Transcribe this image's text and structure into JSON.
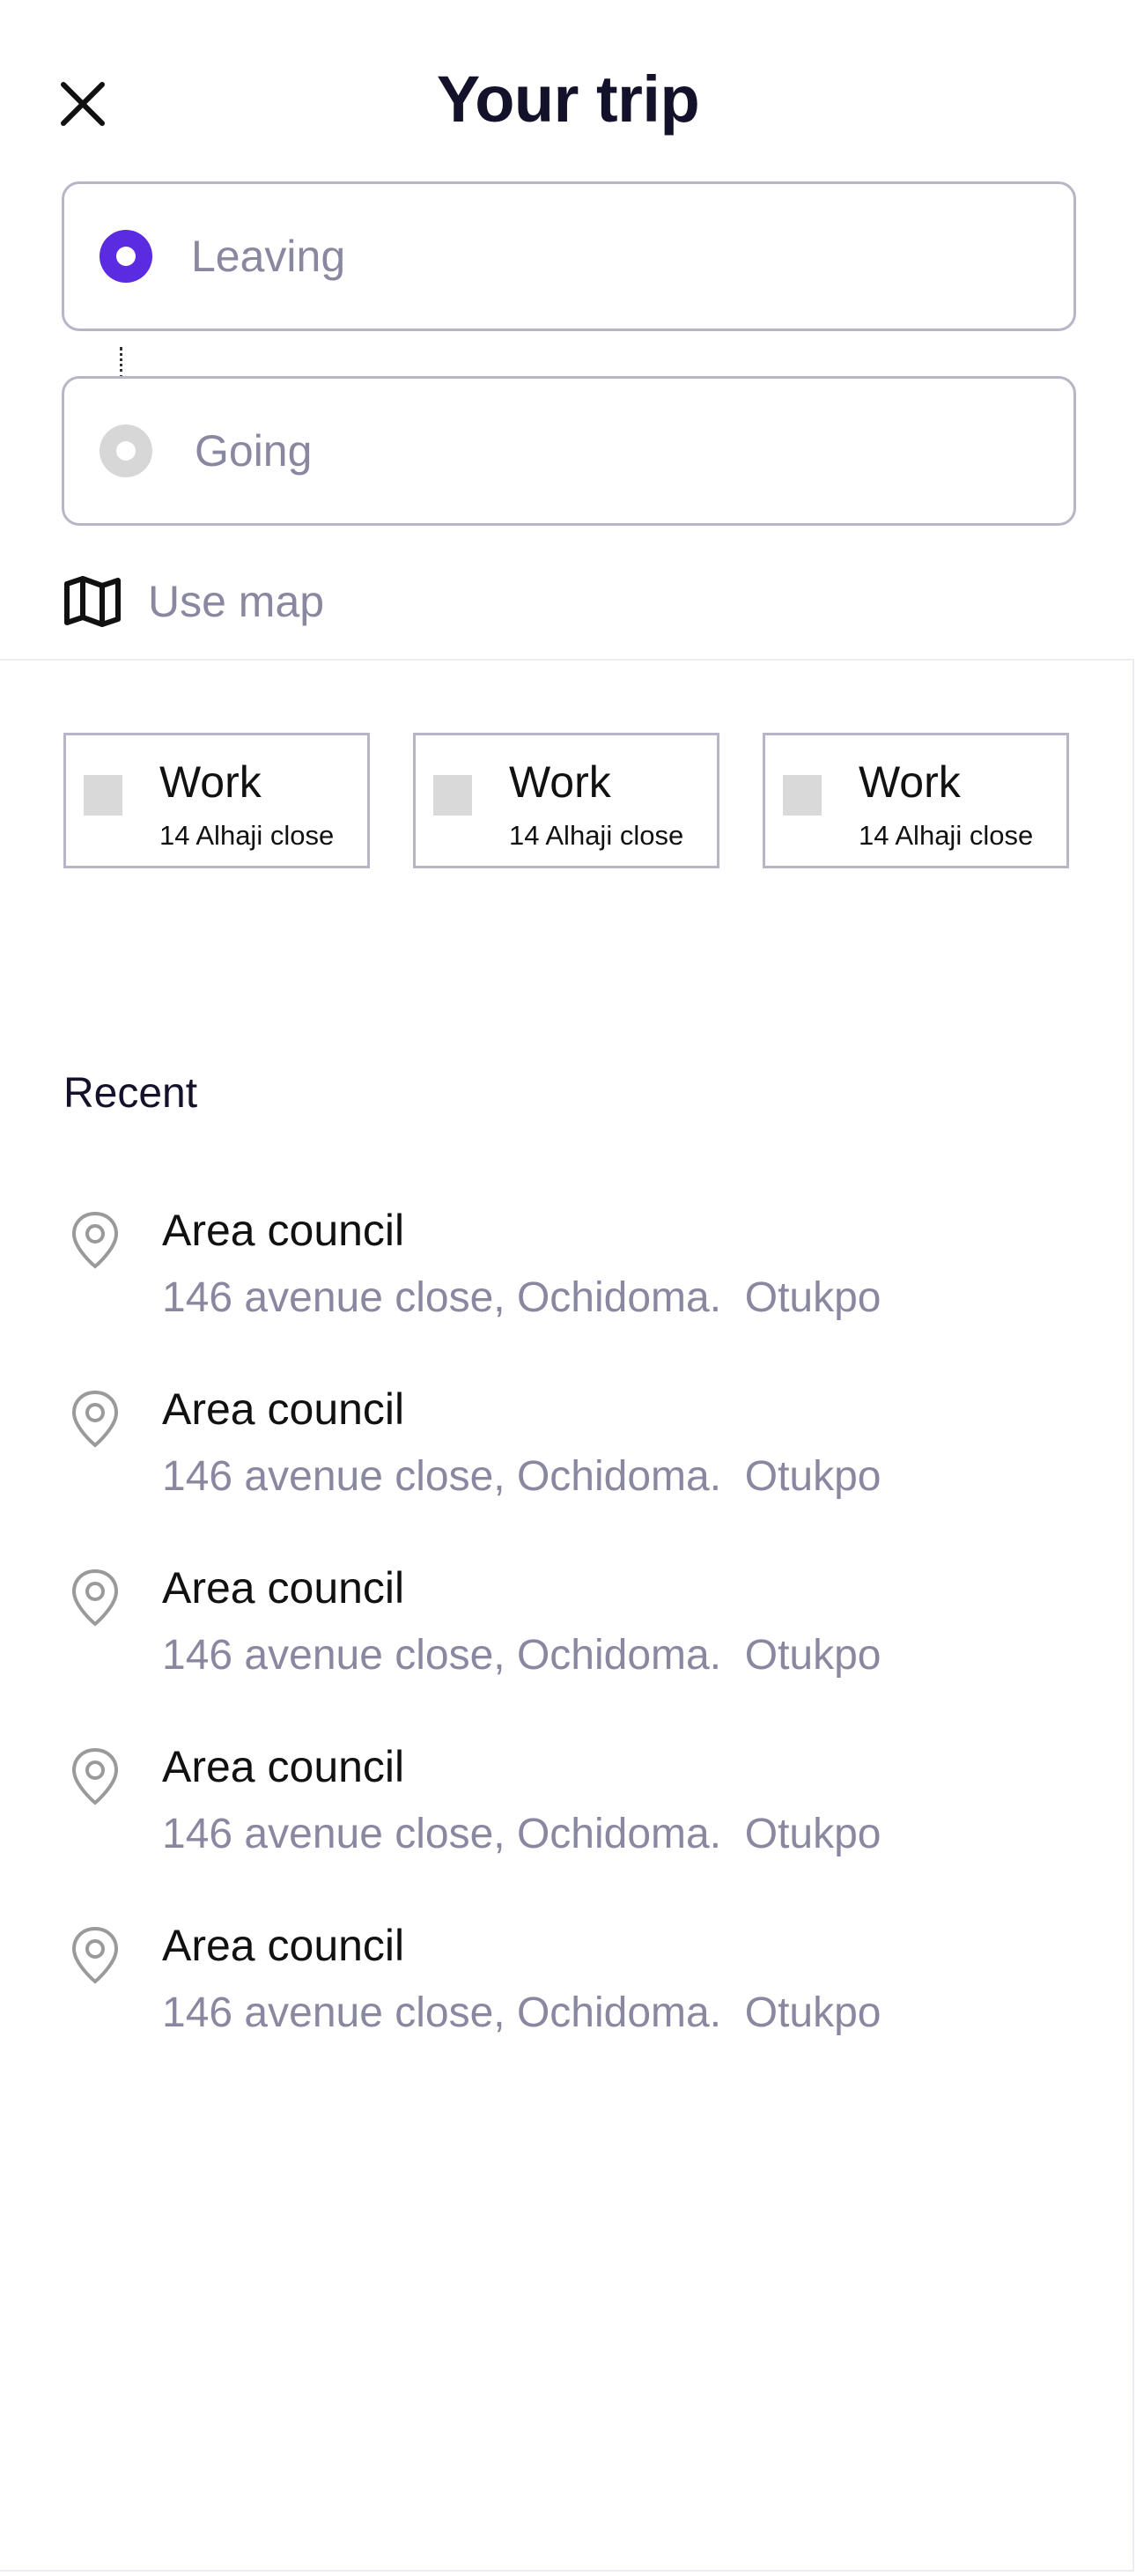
{
  "header": {
    "title": "Your trip",
    "close_icon": "close-icon"
  },
  "trip": {
    "leaving": {
      "placeholder": "Leaving",
      "value": ""
    },
    "going": {
      "placeholder": "Going",
      "value": ""
    }
  },
  "use_map": {
    "label": "Use map",
    "icon": "map-icon"
  },
  "saved_places": [
    {
      "title": "Work",
      "address": "14 Alhaji close"
    },
    {
      "title": "Work",
      "address": "14 Alhaji close"
    },
    {
      "title": "Work",
      "address": "14 Alhaji close"
    }
  ],
  "recent": {
    "heading": "Recent",
    "items": [
      {
        "name": "Area council",
        "address": "146 avenue close, Ochidoma.  Otukpo"
      },
      {
        "name": "Area council",
        "address": "146 avenue close, Ochidoma.  Otukpo"
      },
      {
        "name": "Area council",
        "address": "146 avenue close, Ochidoma.  Otukpo"
      },
      {
        "name": "Area council",
        "address": "146 avenue close, Ochidoma.  Otukpo"
      },
      {
        "name": "Area council",
        "address": "146 avenue close, Ochidoma.  Otukpo"
      }
    ]
  },
  "colors": {
    "accent": "#5a2be0",
    "placeholder": "#8a88a0",
    "title": "#14122b",
    "border": "#b8b6c6",
    "inactive_radio": "#d7d7d7"
  }
}
